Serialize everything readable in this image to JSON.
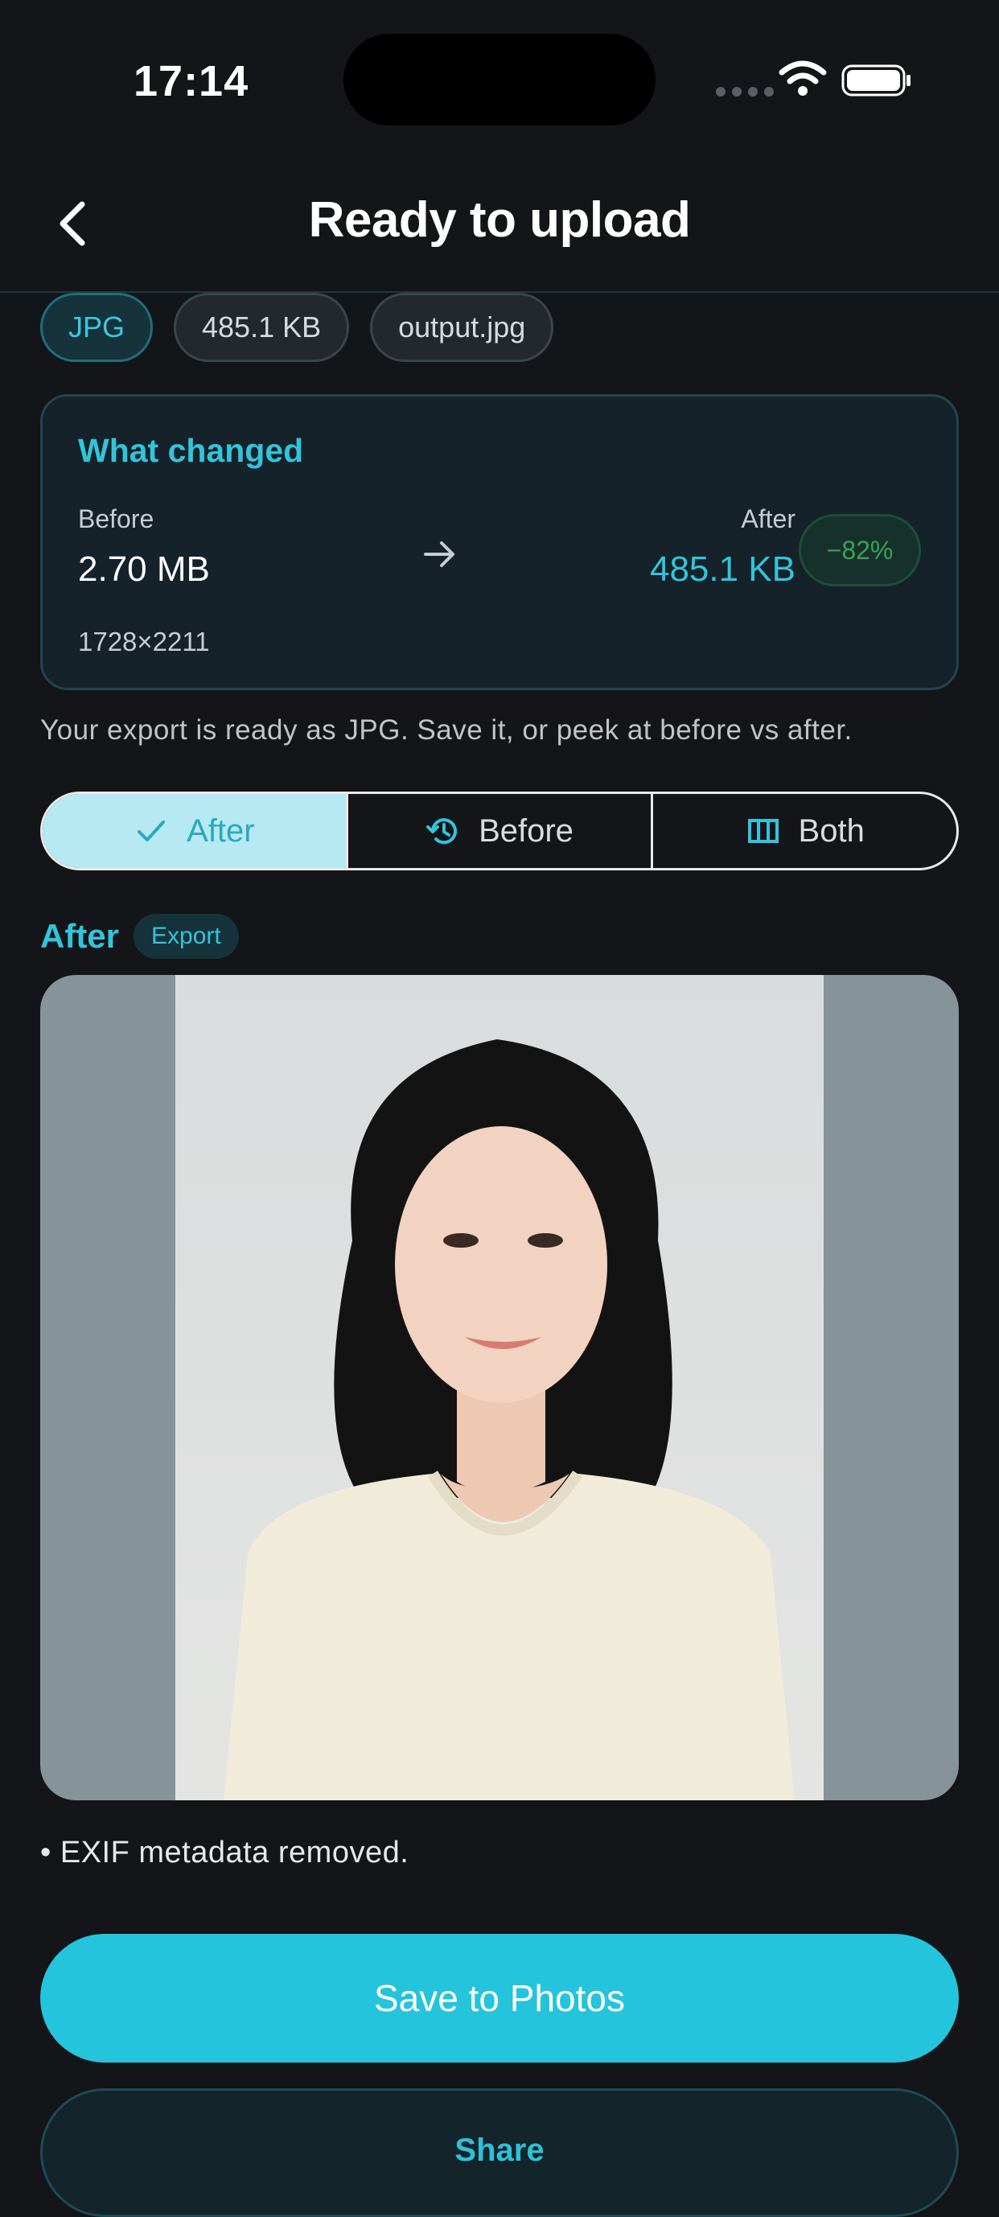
{
  "status_bar": {
    "time": "17:14"
  },
  "nav": {
    "title": "Ready to upload"
  },
  "chips": {
    "format": "JPG",
    "size": "485.1 KB",
    "filename": "output.jpg"
  },
  "changed": {
    "title": "What changed",
    "before_label": "Before",
    "before_value": "2.70 MB",
    "dimensions": "1728×2211",
    "after_label": "After",
    "after_value": "485.1 KB",
    "delta": "−82%"
  },
  "ready_text": "Your export is ready as JPG. Save it, or peek at before vs after.",
  "segments": [
    {
      "label": "After",
      "icon": "check-icon",
      "active": true
    },
    {
      "label": "Before",
      "icon": "history-icon",
      "active": false
    },
    {
      "label": "Both",
      "icon": "columns-icon",
      "active": false
    }
  ],
  "preview": {
    "section_title": "After",
    "badge": "Export"
  },
  "exif_note": "• EXIF metadata removed.",
  "actions": {
    "save_label": "Save to Photos",
    "share_label": "Share"
  },
  "colors": {
    "accent": "#24c4dc",
    "background": "#131518",
    "success": "#3aa257"
  }
}
